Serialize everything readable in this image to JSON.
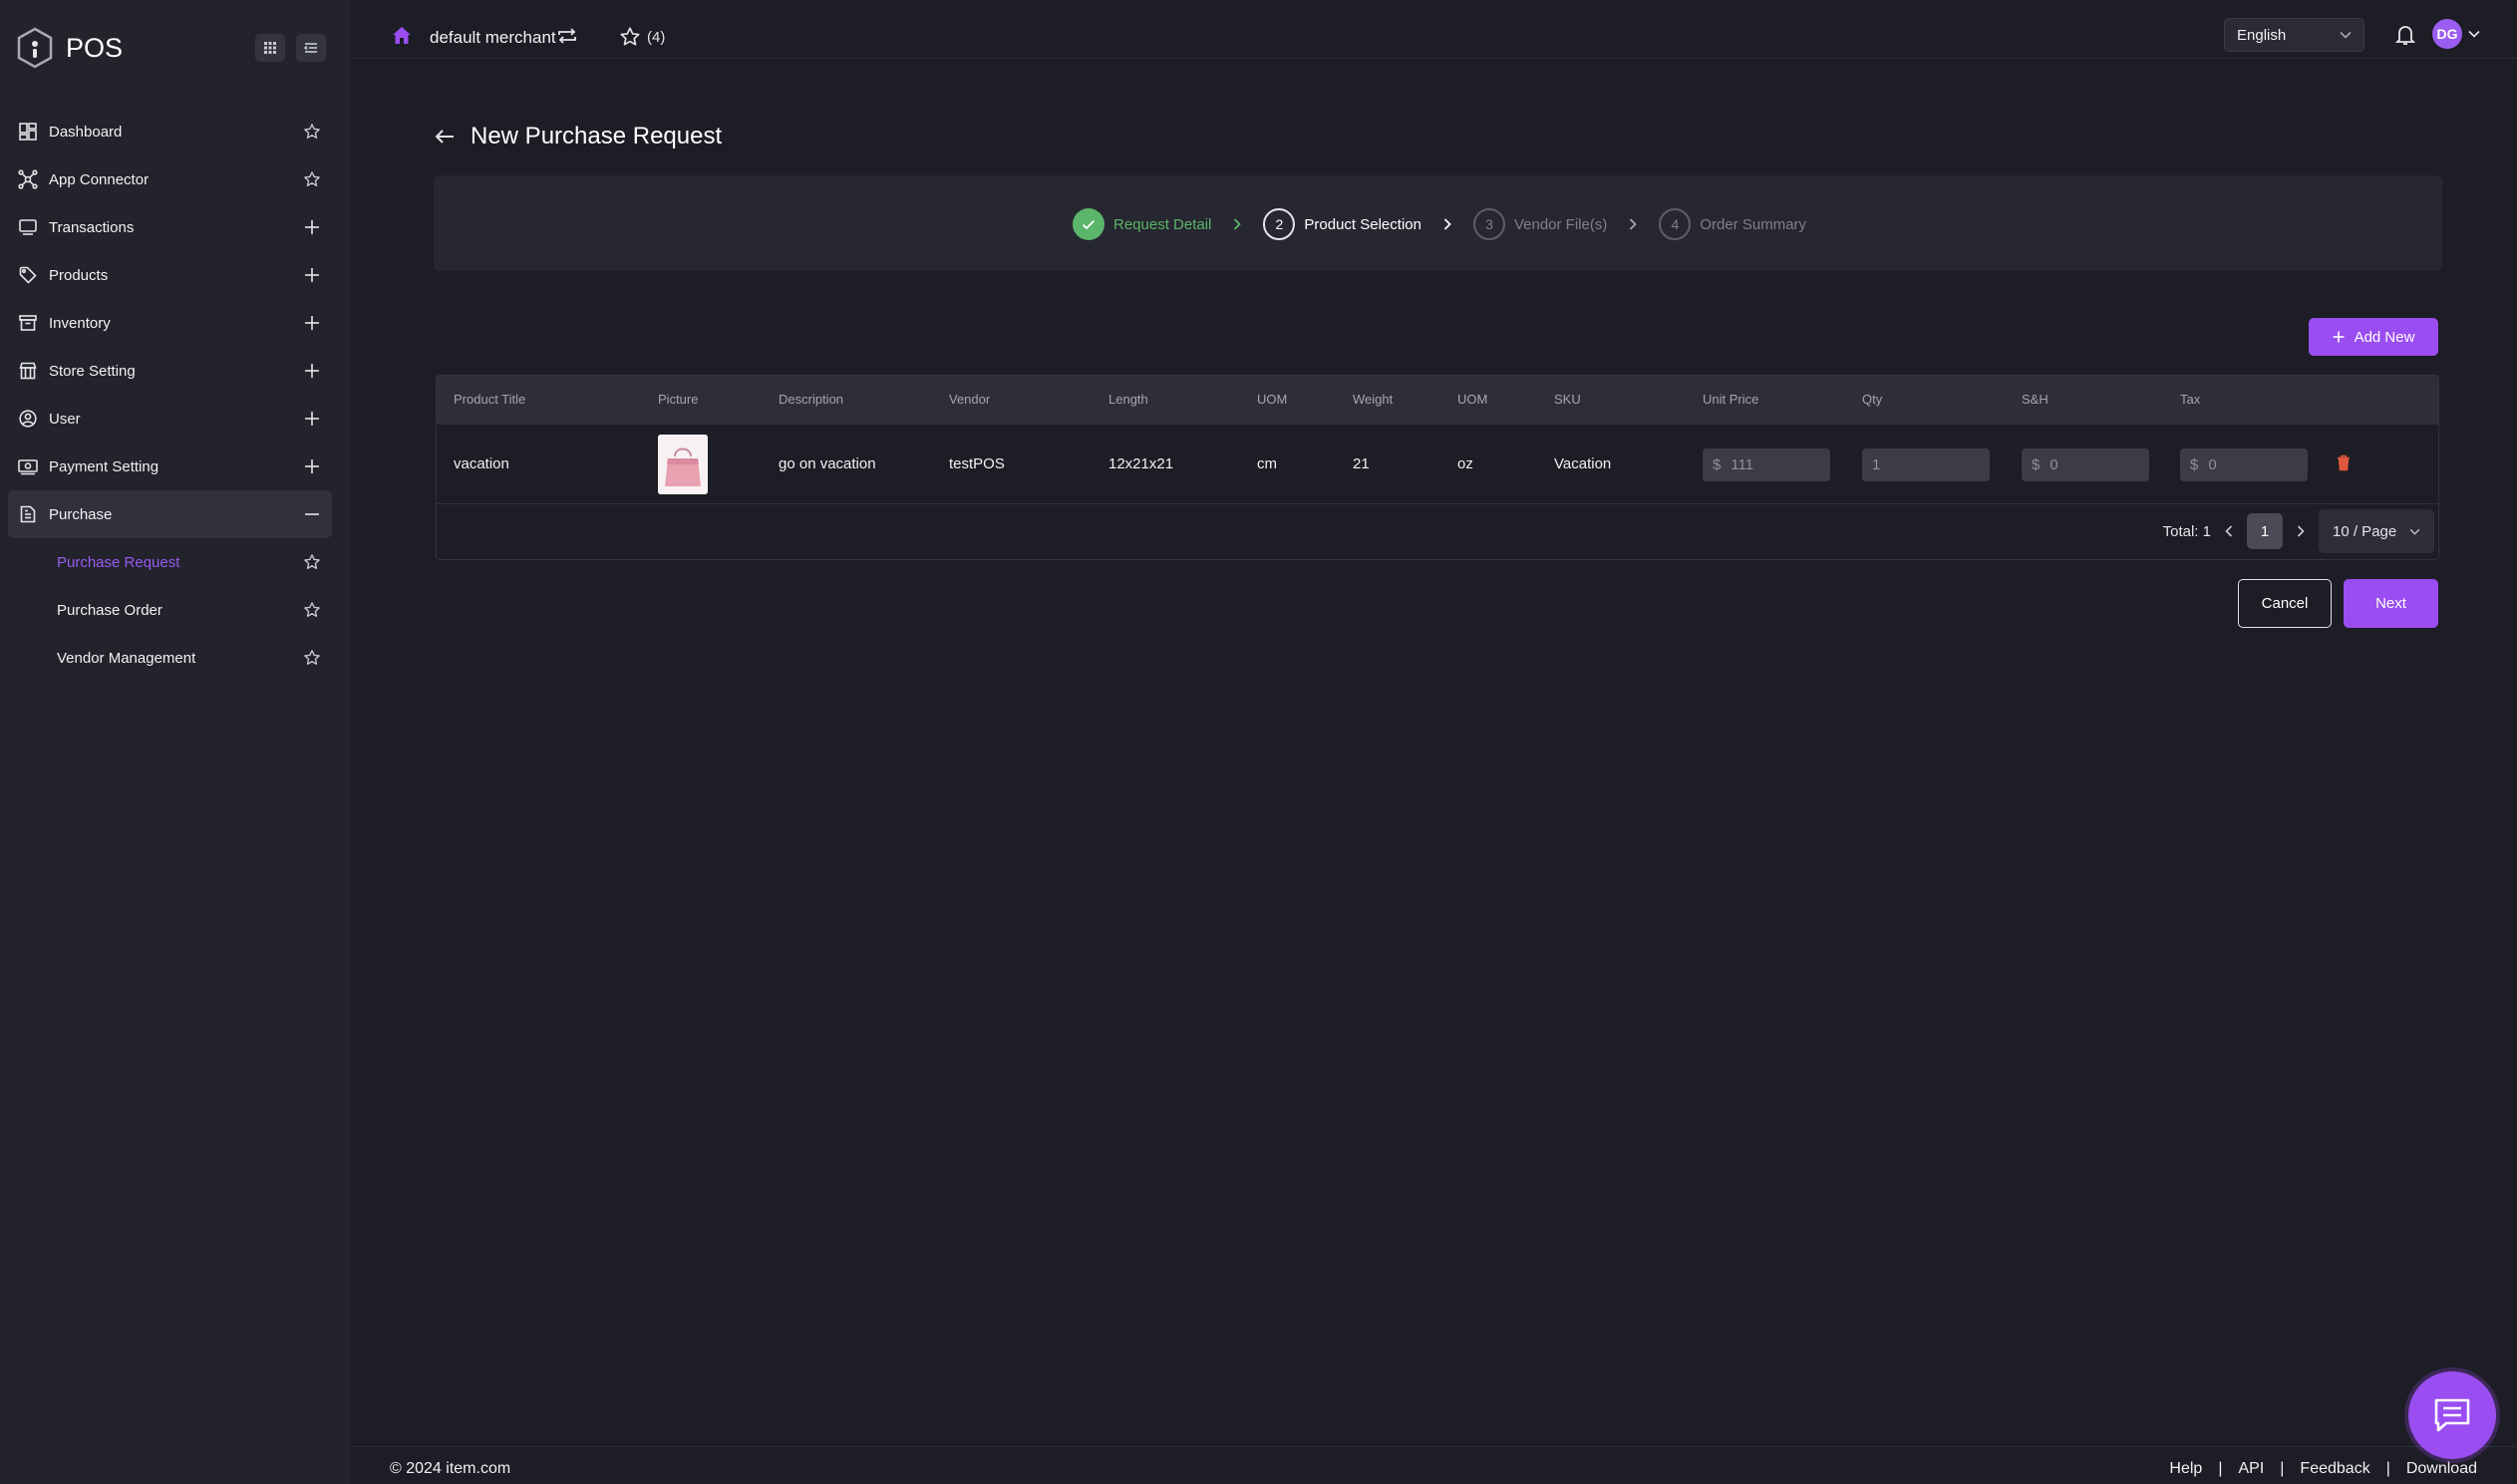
{
  "app": {
    "name": "POS"
  },
  "colors": {
    "accent": "#9a4df0",
    "success": "#5bb56a",
    "danger": "#e0573b"
  },
  "header": {
    "merchant": "default merchant",
    "favorites_count": "(4)",
    "language": "English",
    "avatar_initials": "DG"
  },
  "sidebar": {
    "items": [
      {
        "label": "Dashboard",
        "icon": "dashboard-icon",
        "action": "star"
      },
      {
        "label": "App Connector",
        "icon": "connector-icon",
        "action": "star"
      },
      {
        "label": "Transactions",
        "icon": "transactions-icon",
        "action": "plus"
      },
      {
        "label": "Products",
        "icon": "tag-icon",
        "action": "plus"
      },
      {
        "label": "Inventory",
        "icon": "archive-icon",
        "action": "plus"
      },
      {
        "label": "Store Setting",
        "icon": "store-icon",
        "action": "plus"
      },
      {
        "label": "User",
        "icon": "user-icon",
        "action": "plus"
      },
      {
        "label": "Payment Setting",
        "icon": "payment-icon",
        "action": "plus"
      },
      {
        "label": "Purchase",
        "icon": "document-icon",
        "action": "minus"
      }
    ],
    "purchase_sub": [
      {
        "label": "Purchase Request"
      },
      {
        "label": "Purchase Order"
      },
      {
        "label": "Vendor Management"
      }
    ]
  },
  "main": {
    "title": "New Purchase Request",
    "steps": [
      {
        "label": "Request Detail",
        "number": "",
        "state": "done"
      },
      {
        "label": "Product Selection",
        "number": "2",
        "state": "current"
      },
      {
        "label": "Vendor File(s)",
        "number": "3",
        "state": "pending"
      },
      {
        "label": "Order Summary",
        "number": "4",
        "state": "pending"
      }
    ],
    "add_new_label": "Add New",
    "table": {
      "columns": [
        "Product Title",
        "Picture",
        "Description",
        "Vendor",
        "Length",
        "UOM",
        "Weight",
        "UOM",
        "SKU",
        "Unit Price",
        "Qty",
        "S&H",
        "Tax"
      ],
      "rows": [
        {
          "product_title": "vacation",
          "description": "go on vacation",
          "vendor": "testPOS",
          "length": "12x21x21",
          "length_uom": "cm",
          "weight": "21",
          "weight_uom": "oz",
          "sku": "Vacation",
          "currency": "$",
          "unit_price": "111",
          "qty": "1",
          "sh": "0",
          "tax": "0"
        }
      ]
    },
    "pagination": {
      "total": "Total: 1",
      "page": "1",
      "page_size": "10 / Page"
    },
    "cancel_label": "Cancel",
    "next_label": "Next"
  },
  "footer": {
    "copyright": "© 2024 item.com",
    "links": [
      "Help",
      "API",
      "Feedback",
      "Download"
    ],
    "separator": "|"
  }
}
